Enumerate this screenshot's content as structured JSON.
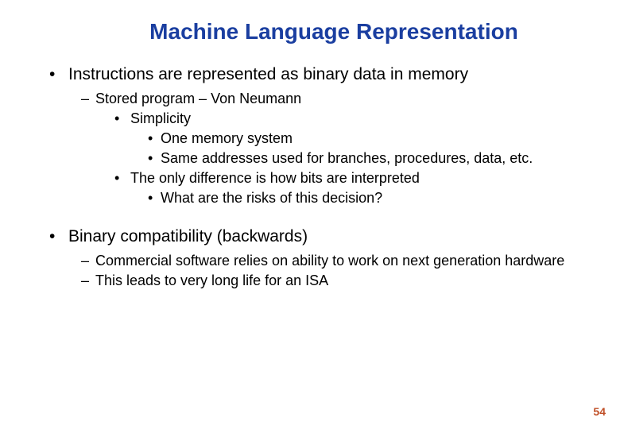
{
  "title": "Machine Language Representation",
  "bullets": {
    "b1": "Instructions are represented as binary data in memory",
    "b1_1": "Stored program – Von Neumann",
    "b1_1_1": "Simplicity",
    "b1_1_1_1": "One memory system",
    "b1_1_1_2": "Same addresses used for branches, procedures, data, etc.",
    "b1_1_2": "The only difference is how bits are interpreted",
    "b1_1_2_1": "What are the risks of this decision?",
    "b2": "Binary compatibility (backwards)",
    "b2_1": "Commercial software relies on ability to work on next generation hardware",
    "b2_2": "This leads to very long life for an ISA"
  },
  "page_number": "54"
}
